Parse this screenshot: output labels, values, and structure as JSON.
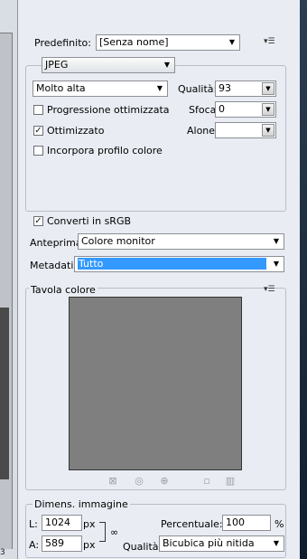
{
  "preset": {
    "label": "Predefinito:",
    "value": "[Senza nome]"
  },
  "format": {
    "value": "JPEG"
  },
  "compression": {
    "value": "Molto alta"
  },
  "quality": {
    "label": "Qualità:",
    "value": "93"
  },
  "blur": {
    "label": "Sfoca:",
    "value": "0"
  },
  "matte": {
    "label": "Alone:",
    "value": ""
  },
  "checkboxes": {
    "progressive": {
      "label": "Progressione ottimizzata",
      "checked": false
    },
    "optimized": {
      "label": "Ottimizzato",
      "checked": true
    },
    "embed_profile": {
      "label": "Incorpora profilo colore",
      "checked": false
    },
    "convert_srgb": {
      "label": "Converti in sRGB",
      "checked": true
    }
  },
  "preview": {
    "label": "Anteprima:",
    "value": "Colore monitor"
  },
  "metadata": {
    "label": "Metadati:",
    "value": "Tutto"
  },
  "color_table": {
    "title": "Tavola colore"
  },
  "image_size": {
    "title": "Dimens. immagine",
    "width_label": "L:",
    "width_value": "1024",
    "width_unit": "px",
    "height_label": "A:",
    "height_value": "589",
    "height_unit": "px",
    "percent_label": "Percentuale:",
    "percent_value": "100",
    "percent_unit": "%",
    "quality_label": "Qualità:",
    "quality_value": "Bicubica più nitida"
  },
  "left_strip": {
    "number": "3"
  },
  "icons": {
    "menu": "panel-menu-icon",
    "link": "chain-link-icon",
    "check": "✓",
    "down": "▼"
  },
  "colors": {
    "selection": "#3399ff",
    "swatch_area": "#7f7f7f"
  }
}
